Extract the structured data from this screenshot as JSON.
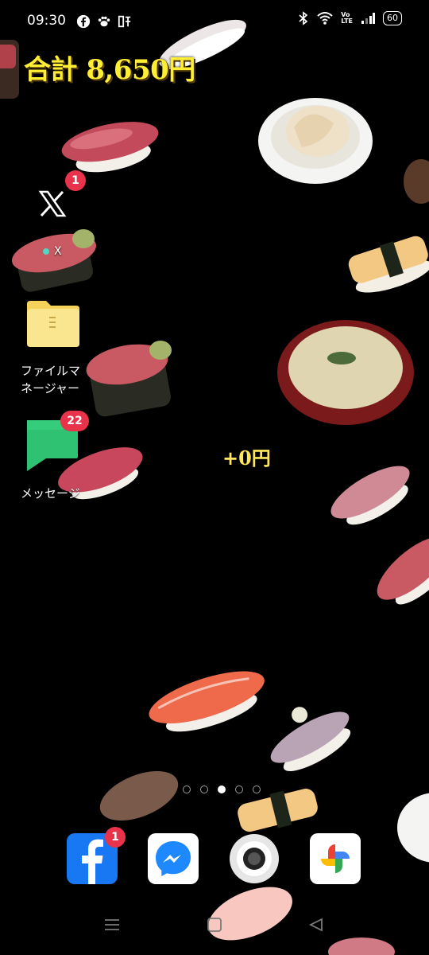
{
  "status_bar": {
    "time": "09:30",
    "left_icons": [
      "facebook-icon",
      "paw-icon",
      "app-kanji-icon"
    ],
    "right_icons": [
      "bluetooth-icon",
      "wifi-icon",
      "volte-icon",
      "signal-icon"
    ],
    "volte_text": "Vo\nLTE",
    "battery": "60"
  },
  "overlay": {
    "total": "合計 8,650円",
    "delta": "+0円"
  },
  "home_apps": [
    {
      "name": "X",
      "badge": "1"
    },
    {
      "name": "X",
      "label": "X"
    },
    {
      "name": "files",
      "label": "ファイルマネージャー",
      "label_line1": "ファイルマ",
      "label_line2": "ネージャー"
    },
    {
      "name": "messages",
      "label": "メッセージ",
      "badge": "22"
    }
  ],
  "page_indicator": {
    "count": 5,
    "active": 2
  },
  "dock": [
    {
      "name": "Facebook",
      "badge": "1"
    },
    {
      "name": "Messenger"
    },
    {
      "name": "Camera"
    },
    {
      "name": "Google Photos"
    }
  ],
  "colors": {
    "total_text": "#ffee33",
    "badge": "#e8334a",
    "facebook_blue": "#1877f2"
  }
}
